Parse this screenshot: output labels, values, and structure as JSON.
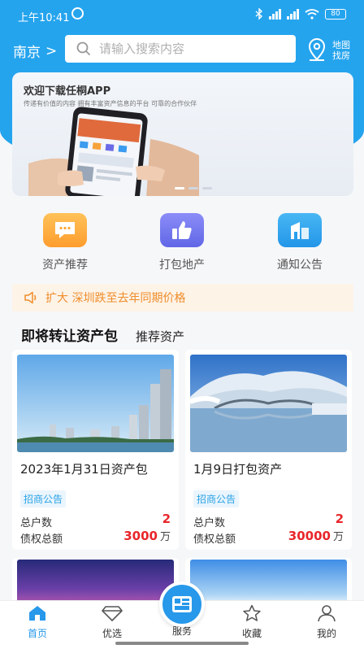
{
  "statusbar": {
    "time": "上午10:41",
    "battery": "80"
  },
  "header": {
    "city": "南京",
    "city_arrow": ">",
    "search_placeholder": "请输入搜索内容",
    "map_label_line1": "地图",
    "map_label_line2": "找房"
  },
  "banner": {
    "title": "欢迎下载任桐APP",
    "subtitle": "传递有价值的内容    拥有丰富资产信息的平台    可靠的合作伙伴"
  },
  "menu": [
    {
      "label": "资产推荐",
      "icon": "chat-icon"
    },
    {
      "label": "打包地产",
      "icon": "thumbs-up-icon"
    },
    {
      "label": "通知公告",
      "icon": "building-icon"
    }
  ],
  "notice": {
    "text": "扩大 深圳跌至去年同期价格"
  },
  "section": {
    "main_tab": "即将转让资产包",
    "sub_tab": "推荐资产"
  },
  "cards": [
    {
      "title": "2023年1月31日资产包",
      "tag": "招商公告",
      "households_label": "总户数",
      "households": "2",
      "debt_label": "债权总额",
      "debt": "3000",
      "debt_unit": "万"
    },
    {
      "title": "1月9日打包资产",
      "tag": "招商公告",
      "households_label": "总户数",
      "households": "2",
      "debt_label": "债权总额",
      "debt": "30000",
      "debt_unit": "万"
    }
  ],
  "tabbar": [
    {
      "label": "首页",
      "icon": "home-icon"
    },
    {
      "label": "优选",
      "icon": "diamond-icon"
    },
    {
      "label": "服务",
      "icon": "service-icon"
    },
    {
      "label": "收藏",
      "icon": "star-icon"
    },
    {
      "label": "我的",
      "icon": "user-icon"
    }
  ],
  "colors": {
    "primary": "#25a4ee",
    "accent_red": "#e8262b",
    "notice_orange": "#f08c2a"
  }
}
